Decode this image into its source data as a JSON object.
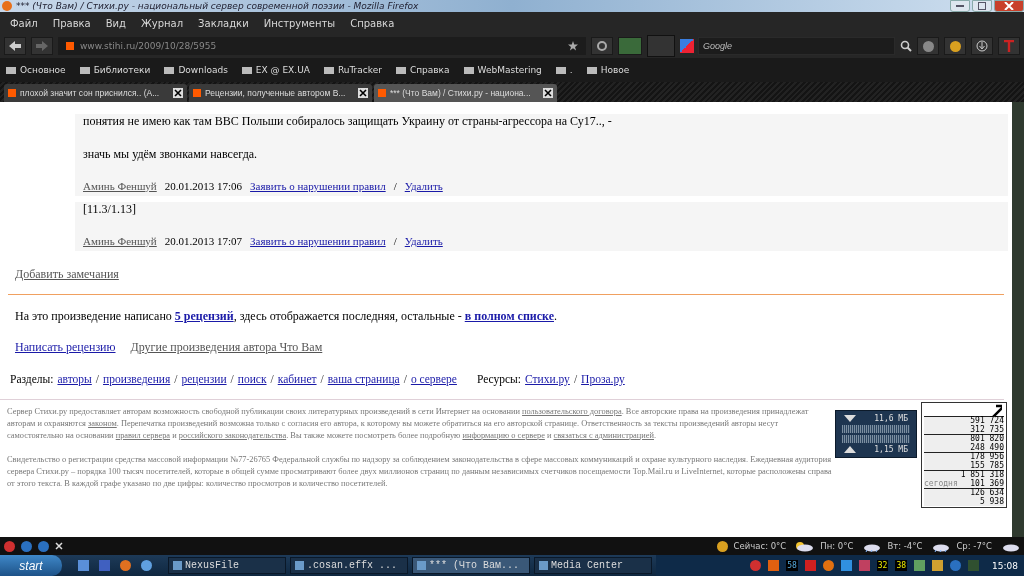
{
  "window": {
    "title": "*** (Что Вам) / Стихи.ру - национальный сервер современной поэзии - Mozilla Firefox"
  },
  "menu": [
    "Файл",
    "Правка",
    "Вид",
    "Журнал",
    "Закладки",
    "Инструменты",
    "Справка"
  ],
  "address": {
    "value": "www.stihi.ru/2009/10/28/5955"
  },
  "search": {
    "placeholder": "Google"
  },
  "bookmarks": [
    {
      "label": "Основное"
    },
    {
      "label": "Библиотеки"
    },
    {
      "label": "Downloads"
    },
    {
      "label": "EX @ EX.UA"
    },
    {
      "label": "RuTracker"
    },
    {
      "label": "Справка"
    },
    {
      "label": "WebMastering"
    },
    {
      "label": "."
    },
    {
      "label": "Новое"
    }
  ],
  "tabs": [
    {
      "label": "плохой значит сон приснился.. (А...",
      "selected": false
    },
    {
      "label": "Рецензии, полученные автором В...",
      "selected": false
    },
    {
      "label": "*** (Что Вам) / Стихи.ру - национа...",
      "selected": true
    }
  ],
  "comments": [
    {
      "lines": [
        "понятия не имею как там ВВС Польши собиралось защищать Украину от страны-агрессора на Су17.., -",
        "значь мы удём звонками навсегда."
      ],
      "author": "Аминь Феншуй",
      "date": "20.01.2013 17:06",
      "report": "Заявить о нарушении правил",
      "separator": "/",
      "delete": "Удалить"
    },
    {
      "lines": [
        "[11.3/1.13]"
      ],
      "author": "Аминь Феншуй",
      "date": "20.01.2013 17:07",
      "report": "Заявить о нарушении правил",
      "separator": "/",
      "delete": "Удалить"
    }
  ],
  "add_note": "Добавить замечания",
  "reviews_line": [
    {
      "text": "На это произведение написано "
    },
    {
      "text": "5 рецензий",
      "link": true
    },
    {
      "text": ", здесь отображается последняя, остальные - "
    },
    {
      "text": "в полном списке",
      "link": true
    },
    {
      "text": "."
    }
  ],
  "write_review": "Написать рецензию",
  "other_works": "Другие произведения автора Что Вам",
  "sections": {
    "label": "Разделы:",
    "separator": "/",
    "links": [
      "авторы",
      "произведения",
      "рецензии",
      "поиск",
      "кабинет",
      "ваша страница",
      "о сервере"
    ]
  },
  "resources": {
    "label": "Ресурсы:",
    "separator": "/",
    "links": [
      "Стихи.ру",
      "Проза.ру"
    ]
  },
  "footer": [
    [
      {
        "text": "Сервер Стихи.ру предоставляет авторам возможность свободной публикации своих литературных произведений в сети Интернет на основании "
      },
      {
        "text": "пользовательского договора",
        "link": true
      },
      {
        "text": ". Все авторские права на произведения принадлежат авторам и охраняются "
      },
      {
        "text": "законом",
        "link": true
      },
      {
        "text": ". Перепечатка произведений возможна только с согласия его автора, к которому вы можете обратиться на его авторской странице. Ответственность за тексты произведений авторы несут самостоятельно на основании "
      },
      {
        "text": "правил сервера",
        "link": true
      },
      {
        "text": " и "
      },
      {
        "text": "российского законодательства",
        "link": true
      },
      {
        "text": ". Вы также можете посмотреть более подробную "
      },
      {
        "text": "информацию о сервере",
        "link": true
      },
      {
        "text": " и "
      },
      {
        "text": "связаться с администрацией",
        "link": true
      },
      {
        "text": "."
      }
    ],
    [
      {
        "text": "Свидетельство о регистрации средства массовой информации №77-26765 Федеральной службы по надзору за соблюдением законодательства в сфере массовых коммуникаций и охране культурного наследия. Ежедневная аудитория сервера Стихи.ру – порядка 100 тысяч посетителей, которые в общей сумме просматривают более двух миллионов страниц по данным независимых счетчиков посещаемости Top.Mail.ru и LiveInternet, которые расположены справа от этого текста. В каждой графе указано по две цифры: количество просмотров и количество посетителей."
      }
    ]
  ],
  "counter": {
    "rows": [
      [
        "591 724",
        "312 735"
      ],
      [
        "801 820",
        "248 490"
      ],
      [
        "178 956",
        "155 785"
      ],
      [
        "1 851 318",
        "101 369"
      ],
      [
        "126 634",
        "5 938"
      ]
    ],
    "today": "сегодня"
  },
  "network": {
    "download": "11,6 МБ",
    "upload": "1,15 МБ"
  },
  "status_bar": {
    "weather": [
      {
        "text": "Сейчас: 0°C",
        "kind": "sun"
      },
      {
        "text": "Пн: 0°C",
        "kind": "rain"
      },
      {
        "text": "Вт: -4°C",
        "kind": "rain"
      },
      {
        "text": "Ср: -7°C",
        "kind": "cloud"
      }
    ]
  },
  "taskbar": {
    "start": "start",
    "items": [
      {
        "label": "NexusFile",
        "selected": false
      },
      {
        "label": ".cosan.effx ...",
        "selected": false
      },
      {
        "label": "*** (Что Вам...",
        "selected": true
      },
      {
        "label": "Media Center",
        "selected": false
      }
    ],
    "tray_numbers": [
      "58",
      "32",
      "38"
    ],
    "clock": "15:08"
  }
}
